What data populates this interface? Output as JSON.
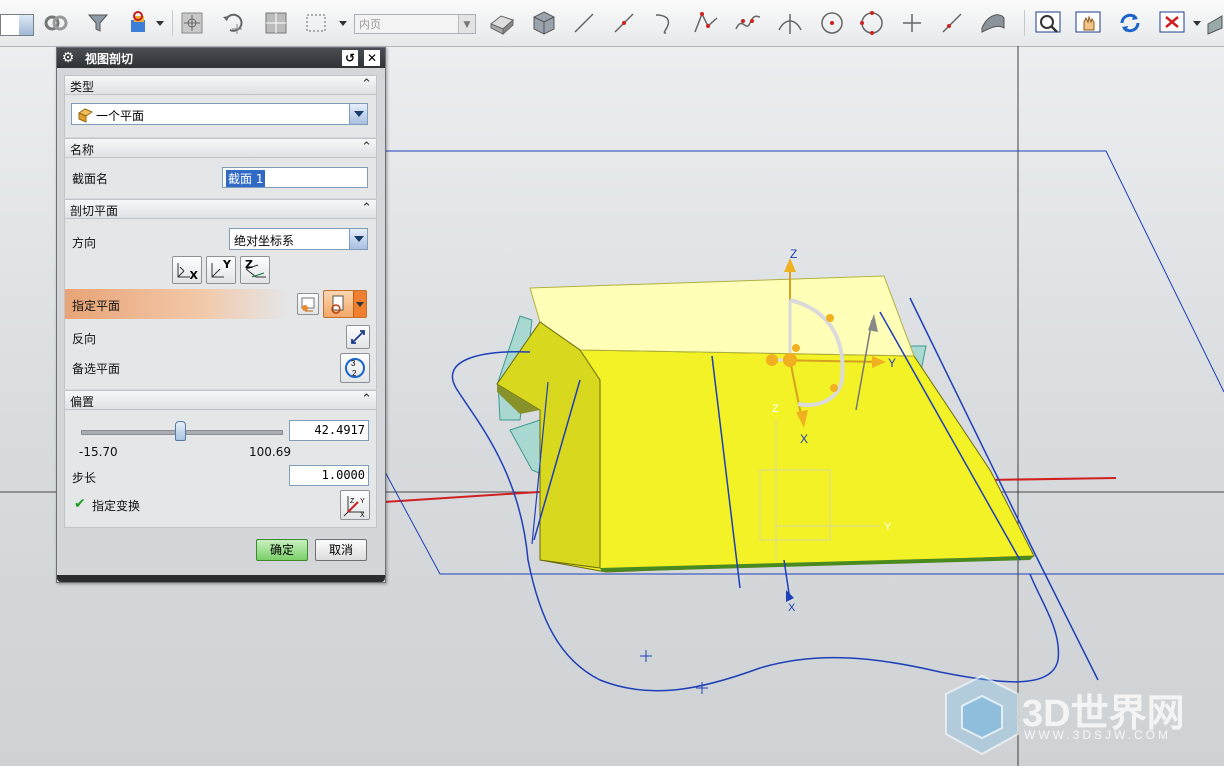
{
  "toolbar": {
    "combo_placeholder": "内页",
    "icons": [
      "chain-icon",
      "filter-icon",
      "csys-icon",
      "sim-icon",
      "snap-grid-icon",
      "rotate-snap-icon",
      "snap-box-icon",
      "selection-box-icon",
      "view-box-icon",
      "solid-icon",
      "line-icon",
      "line2-icon",
      "arc-icon",
      "polyline-icon",
      "spline-icon",
      "intersect-icon",
      "circle-icon",
      "circle2-icon",
      "point-icon",
      "diag-line-icon",
      "surface-icon",
      "zoom-window-icon",
      "pan-icon",
      "refresh-icon",
      "fit-icon",
      "render-style-icon"
    ]
  },
  "dialog": {
    "title": "视图剖切",
    "reset_glyph": "↺",
    "close_glyph": "✕",
    "type_section": {
      "label": "类型",
      "value": "一个平面"
    },
    "name_section": {
      "label": "名称",
      "field_label": "截面名",
      "field_value": "截面 1"
    },
    "plane_section": {
      "label": "剖切平面",
      "direction_label": "方向",
      "direction_value": "绝对坐标系",
      "axis_buttons": [
        "X",
        "Y",
        "Z"
      ],
      "specify_plane_label": "指定平面",
      "reverse_label": "反向",
      "alt_plane_label": "备选平面"
    },
    "offset_section": {
      "label": "偏置",
      "value": "42.4917",
      "min_label": "-15.70",
      "max_label": "100.69",
      "slider_fraction": 0.497,
      "step_label": "步长",
      "step_value": "1.0000",
      "transform_label": "指定变换"
    },
    "ok_label": "确定",
    "cancel_label": "取消"
  },
  "viewport": {
    "axis_labels": {
      "z": "Z",
      "y": "Y",
      "x": "X",
      "z2": "Z",
      "y2": "Y",
      "x2": "X"
    },
    "colors": {
      "part_yellow": "#ffff33",
      "part_light": "#ffffb0",
      "section_blue": "#1e3fb8",
      "axis_red": "#d02020",
      "plane_teal": "#5fb8b0"
    }
  },
  "watermark": {
    "brand": "3D世界网",
    "url": "WWW.3DSJW.COM"
  }
}
